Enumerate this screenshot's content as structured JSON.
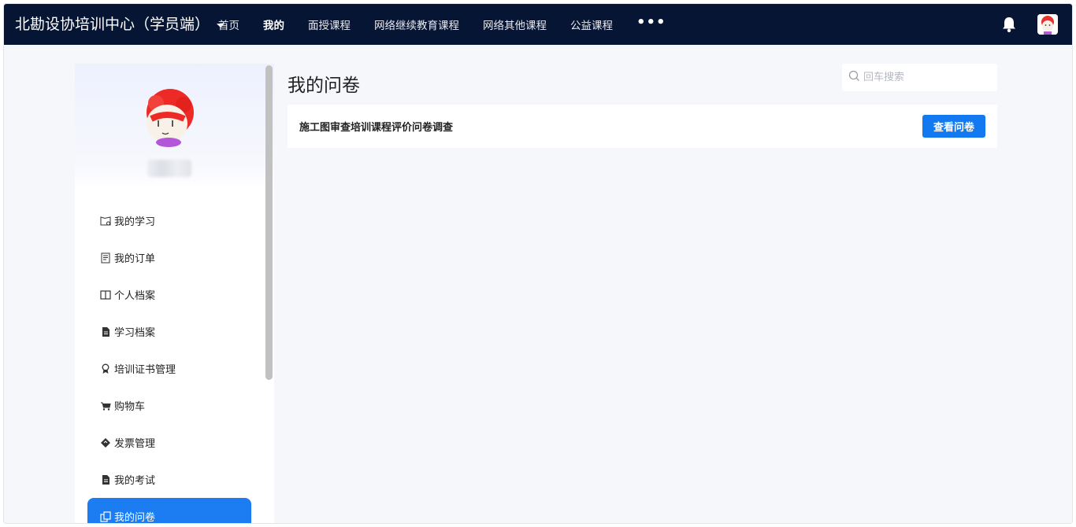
{
  "header": {
    "brand": "北勘设协培训中心（学员端）",
    "nav": [
      {
        "label": "首页"
      },
      {
        "label": "我的"
      },
      {
        "label": "面授课程"
      },
      {
        "label": "网络继续教育课程"
      },
      {
        "label": "网络其他课程"
      },
      {
        "label": "公益课程"
      }
    ],
    "more_label": "•••",
    "icons": {
      "notifications": "bell-icon",
      "user": "avatar"
    }
  },
  "sidebar": {
    "menu": [
      {
        "label": "我的学习",
        "icon": "study-icon"
      },
      {
        "label": "我的订单",
        "icon": "order-icon"
      },
      {
        "label": "个人档案",
        "icon": "profile-book-icon"
      },
      {
        "label": "学习档案",
        "icon": "file-icon"
      },
      {
        "label": "培训证书管理",
        "icon": "certificate-icon"
      },
      {
        "label": "购物车",
        "icon": "cart-icon"
      },
      {
        "label": "发票管理",
        "icon": "ticket-icon"
      },
      {
        "label": "我的考试",
        "icon": "file-icon"
      },
      {
        "label": "我的问卷",
        "icon": "survey-icon",
        "active": true
      }
    ]
  },
  "main": {
    "title": "我的问卷",
    "search": {
      "placeholder": "回车搜索",
      "value": ""
    },
    "surveys": [
      {
        "title": "施工图审查培训课程评价问卷调查",
        "action": "查看问卷"
      }
    ]
  },
  "colors": {
    "topbar": "#071534",
    "accent": "#1379f0",
    "background": "#f6f7fb"
  }
}
